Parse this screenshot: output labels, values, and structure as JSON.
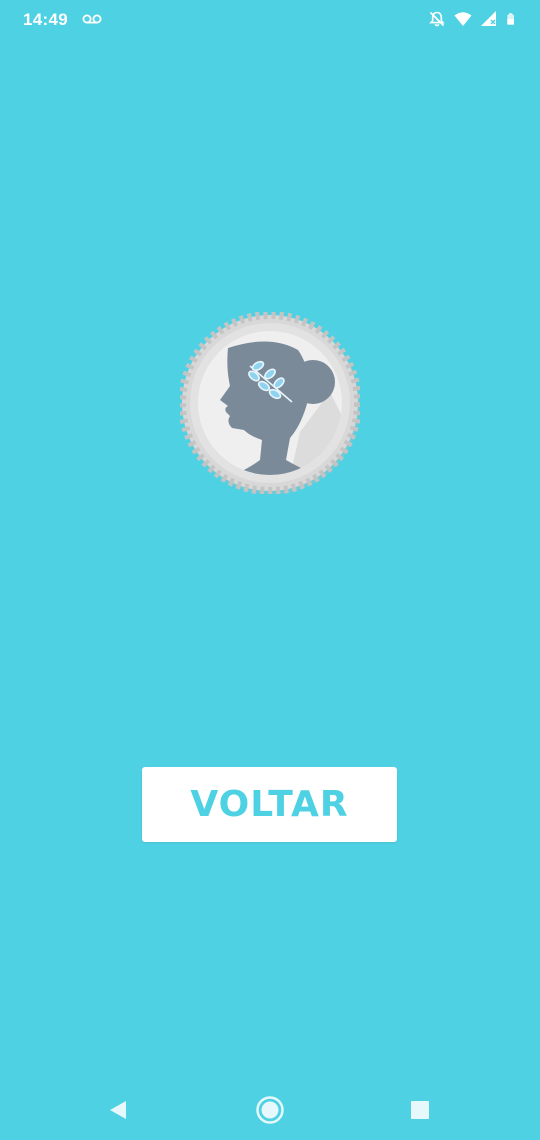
{
  "status_bar": {
    "time": "14:49",
    "icons": [
      "voicemail-icon",
      "notifications-off-icon",
      "wifi-icon",
      "signal-icon",
      "battery-icon"
    ]
  },
  "main": {
    "logo_icon": "coin-woman-profile-icon",
    "voltar_label": "VOLTAR"
  },
  "nav": {
    "icons": [
      "back-icon",
      "home-icon",
      "recents-icon"
    ]
  },
  "colors": {
    "background": "#4ed1e3",
    "button_bg": "#ffffff",
    "button_text": "#4ed1e3",
    "coin_silhouette": "#7a8a99",
    "leaf": "#8fd3f0"
  }
}
